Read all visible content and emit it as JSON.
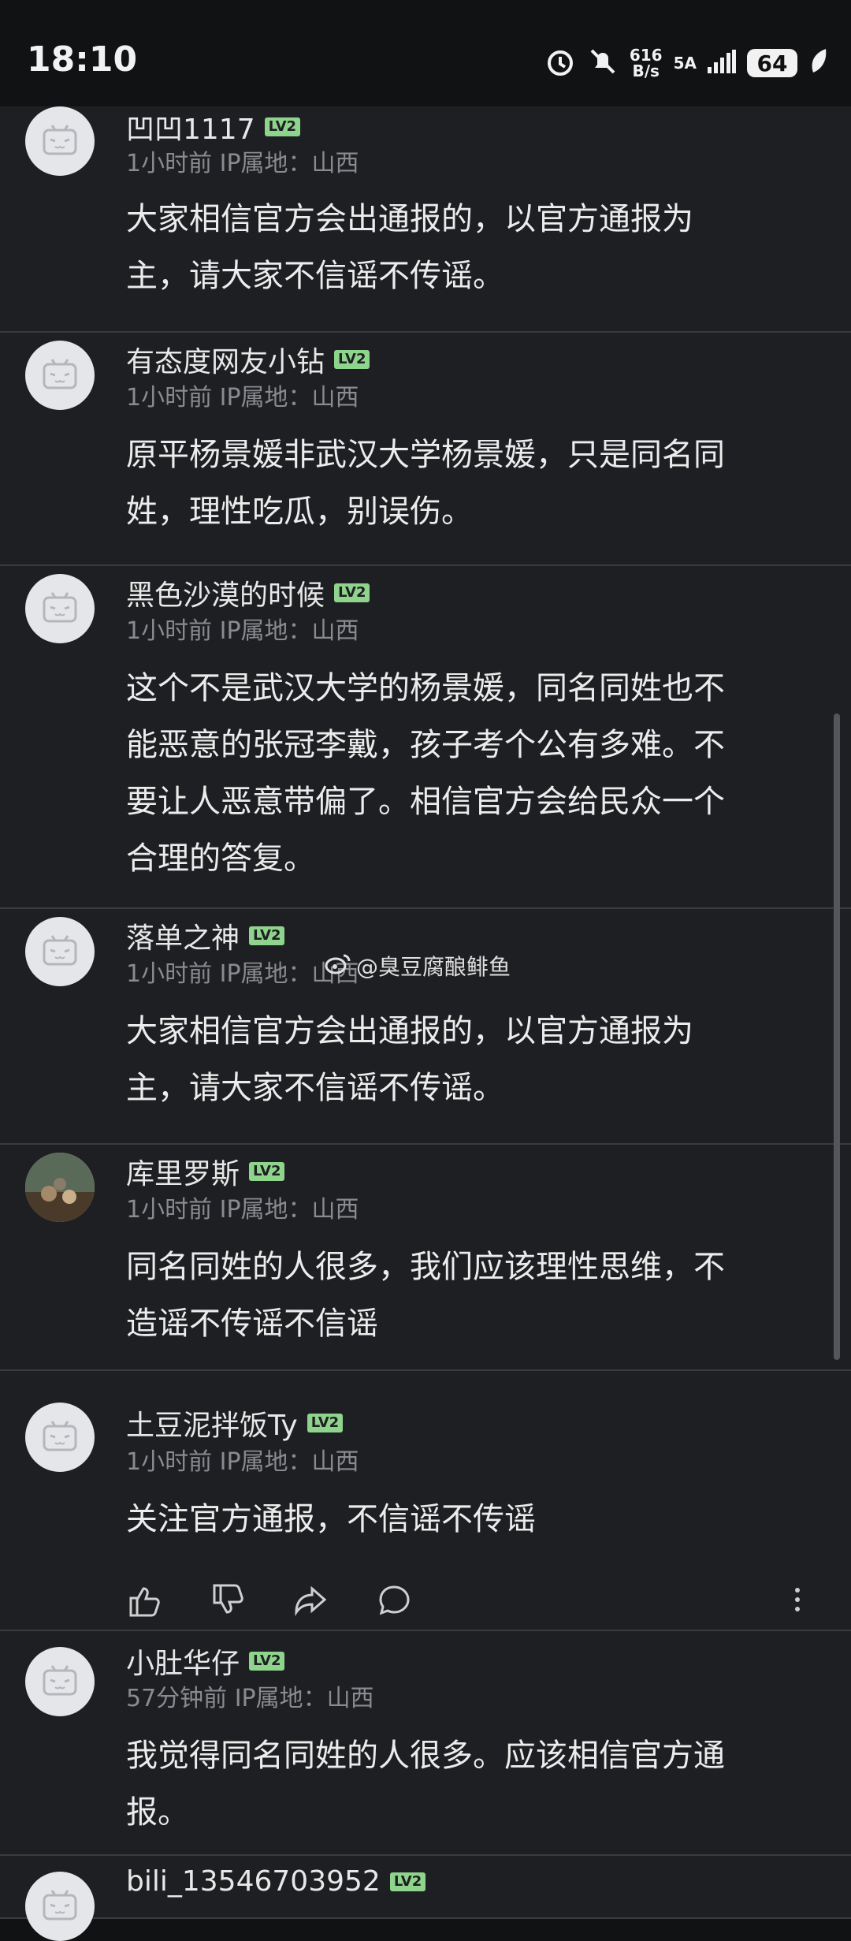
{
  "status": {
    "time": "18:10",
    "net_speed_top": "616",
    "net_speed_bottom": "B/s",
    "signal_label": "5A",
    "battery": "64"
  },
  "comments": [
    {
      "user": "凹凹1117",
      "level": "LV2",
      "meta": "1小时前 IP属地：山西",
      "lines": [
        "大家相信官方会出通报的，以官方通报为",
        "主，请大家不信谣不传谣。"
      ]
    },
    {
      "user": "有态度网友小钻",
      "level": "LV2",
      "meta": "1小时前 IP属地：山西",
      "lines": [
        "原平杨景媛非武汉大学杨景媛，只是同名同",
        "姓，理性吃瓜，别误伤。"
      ]
    },
    {
      "user": "黑色沙漠的时候",
      "level": "LV2",
      "meta": "1小时前 IP属地：山西",
      "lines": [
        "这个不是武汉大学的杨景媛，同名同姓也不",
        "能恶意的张冠李戴，孩子考个公有多难。不",
        "要让人恶意带偏了。相信官方会给民众一个",
        "合理的答复。"
      ]
    },
    {
      "user": "落单之神",
      "level": "LV2",
      "meta": "1小时前 IP属地：山西",
      "lines": [
        "大家相信官方会出通报的，以官方通报为",
        "主，请大家不信谣不传谣。"
      ]
    },
    {
      "user": "库里罗斯",
      "level": "LV2",
      "meta": "1小时前 IP属地：山西",
      "lines": [
        "同名同姓的人很多，我们应该理性思维，不",
        "造谣不传谣不信谣"
      ]
    },
    {
      "user": "土豆泥拌饭Ty",
      "level": "LV2",
      "meta": "1小时前 IP属地：山西",
      "lines": [
        "关注官方通报，不信谣不传谣"
      ]
    },
    {
      "user": "小肚华仔",
      "level": "LV2",
      "meta": "57分钟前 IP属地：山西",
      "lines": [
        "我觉得同名同姓的人很多。应该相信官方通",
        "报。"
      ]
    },
    {
      "user": "bili_13546703952",
      "level": "LV2",
      "meta": "",
      "lines": []
    }
  ],
  "watermark": "@臭豆腐酿鲱鱼"
}
